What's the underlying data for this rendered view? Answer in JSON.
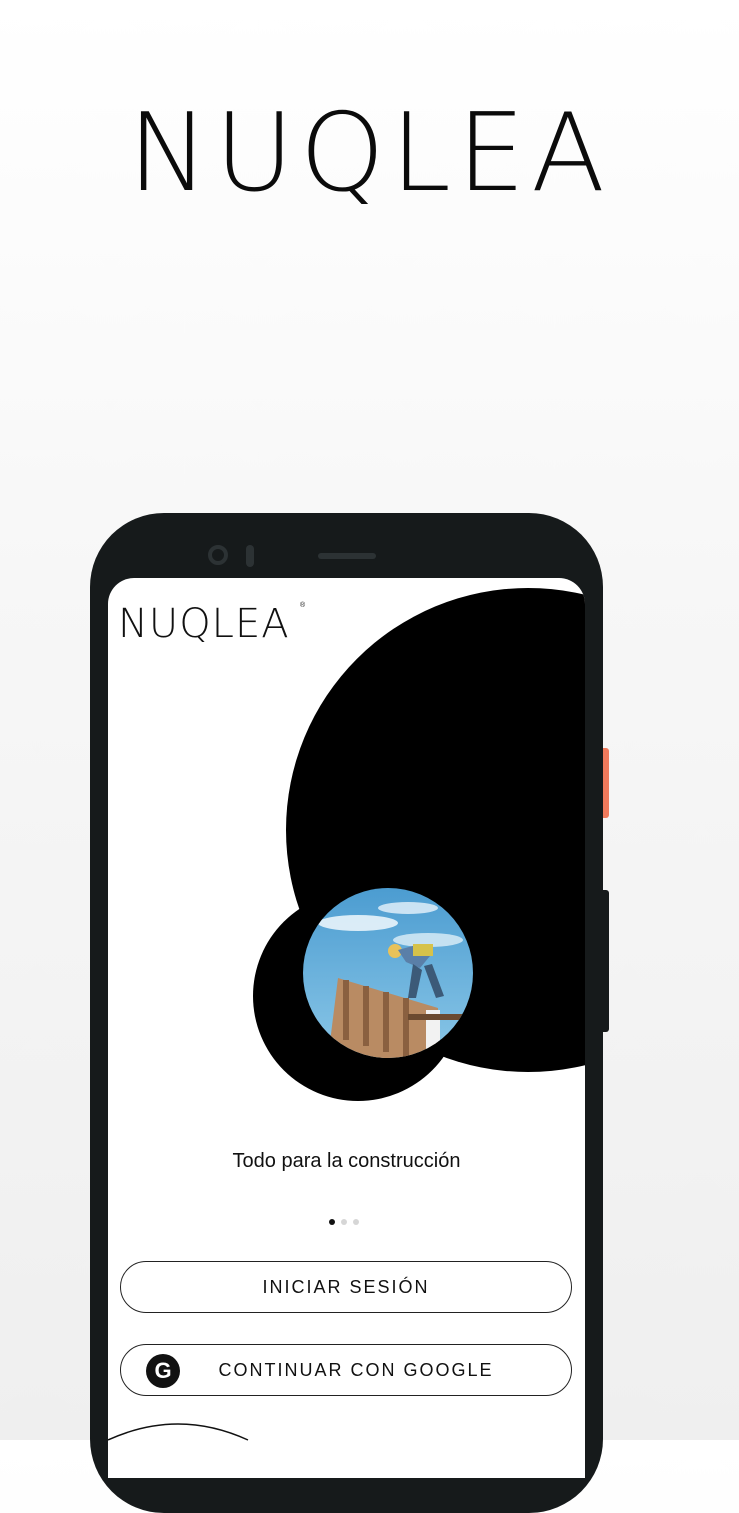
{
  "brand": {
    "logo_text": "NUQLEA"
  },
  "phone_screen": {
    "logo_text": "NUQLEA",
    "logo_mark": "®",
    "tagline": "Todo para la construcción",
    "carousel": {
      "page_count": 3,
      "active_index": 0
    },
    "buttons": {
      "login_label": "INICIAR SESIÓN",
      "google_label": "CONTINUAR CON GOOGLE",
      "google_icon": "google-icon"
    }
  },
  "colors": {
    "accent_side_button": "#f07a5c",
    "phone_body": "#161a1b",
    "circle": "#000000"
  }
}
